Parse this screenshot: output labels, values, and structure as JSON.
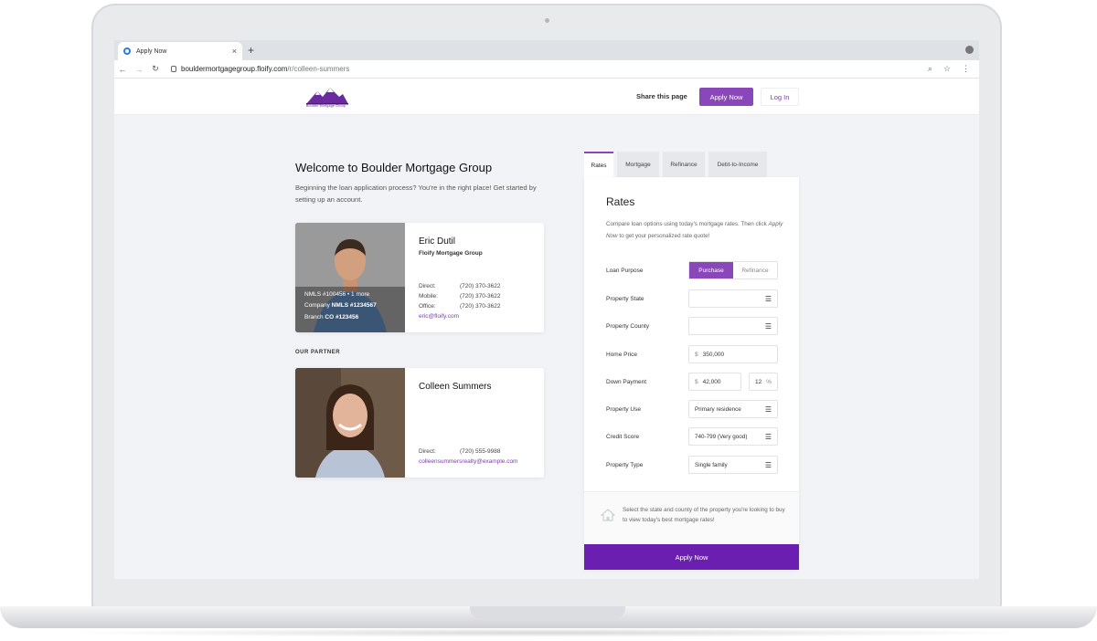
{
  "browser": {
    "tab_title": "Apply Now",
    "tab_close": "×",
    "new_tab": "+",
    "url_host": "bouldermortgagegroup.floify.com",
    "url_path": "/r/colleen-summers",
    "nav_back": "←",
    "nav_forward": "→",
    "nav_reload": "↻"
  },
  "header": {
    "logo_text": "Boulder Mortgage Group",
    "share_label": "Share this page",
    "apply_label": "Apply Now",
    "login_label": "Log In"
  },
  "welcome": {
    "title": "Welcome to Boulder Mortgage Group",
    "intro": "Beginning the loan application process? You're in the right place! Get started by setting up an account."
  },
  "loan_officer": {
    "name": "Eric Dutil",
    "company": "Floify Mortgage Group",
    "nmls": "NMLS #100456",
    "nmls_more": " • 1 more",
    "company_nmls_label": "Company ",
    "company_nmls": "NMLS #1234567",
    "branch_label": "Branch ",
    "branch": "CO #123456",
    "direct_label": "Direct:",
    "direct": "(720) 370-3622",
    "mobile_label": "Mobile:",
    "mobile": "(720) 370-3622",
    "office_label": "Office:",
    "office": "(720) 370-3622",
    "email": "eric@floify.com"
  },
  "partner": {
    "section_label": "OUR PARTNER",
    "name": "Colleen Summers",
    "direct_label": "Direct:",
    "direct": "(720) 555-9988",
    "email": "colleensummersrealty@example.com"
  },
  "rates_panel": {
    "tabs": [
      "Rates",
      "Mortgage",
      "Refinance",
      "Debt-to-Income"
    ],
    "title": "Rates",
    "desc_1": "Compare loan options using today's mortgage rates. Then click ",
    "desc_em": "Apply Now",
    "desc_2": " to get your personalized rate quote!",
    "loan_purpose_label": "Loan Purpose",
    "loan_purpose_options": [
      "Purchase",
      "Refinance"
    ],
    "loan_purpose_selected": "Purchase",
    "property_state_label": "Property State",
    "property_state_value": "",
    "property_county_label": "Property County",
    "property_county_value": "",
    "home_price_label": "Home Price",
    "currency": "$",
    "home_price_value": "350,000",
    "down_payment_label": "Down Payment",
    "down_payment_value": "42,000",
    "down_payment_pct": "12",
    "pct_symbol": "%",
    "property_use_label": "Property Use",
    "property_use_value": "Primary residence",
    "credit_score_label": "Credit Score",
    "credit_score_value": "740-799 (Very good)",
    "property_type_label": "Property Type",
    "property_type_value": "Single family",
    "footer_note": "Select the state and county of the property you're looking to buy to view today's best mortgage rates!",
    "apply_label": "Apply Now"
  },
  "colors": {
    "brand_purple": "#8a47b9",
    "apply_bottom": "#6b1fb0",
    "link_purple": "#7a3cab"
  }
}
